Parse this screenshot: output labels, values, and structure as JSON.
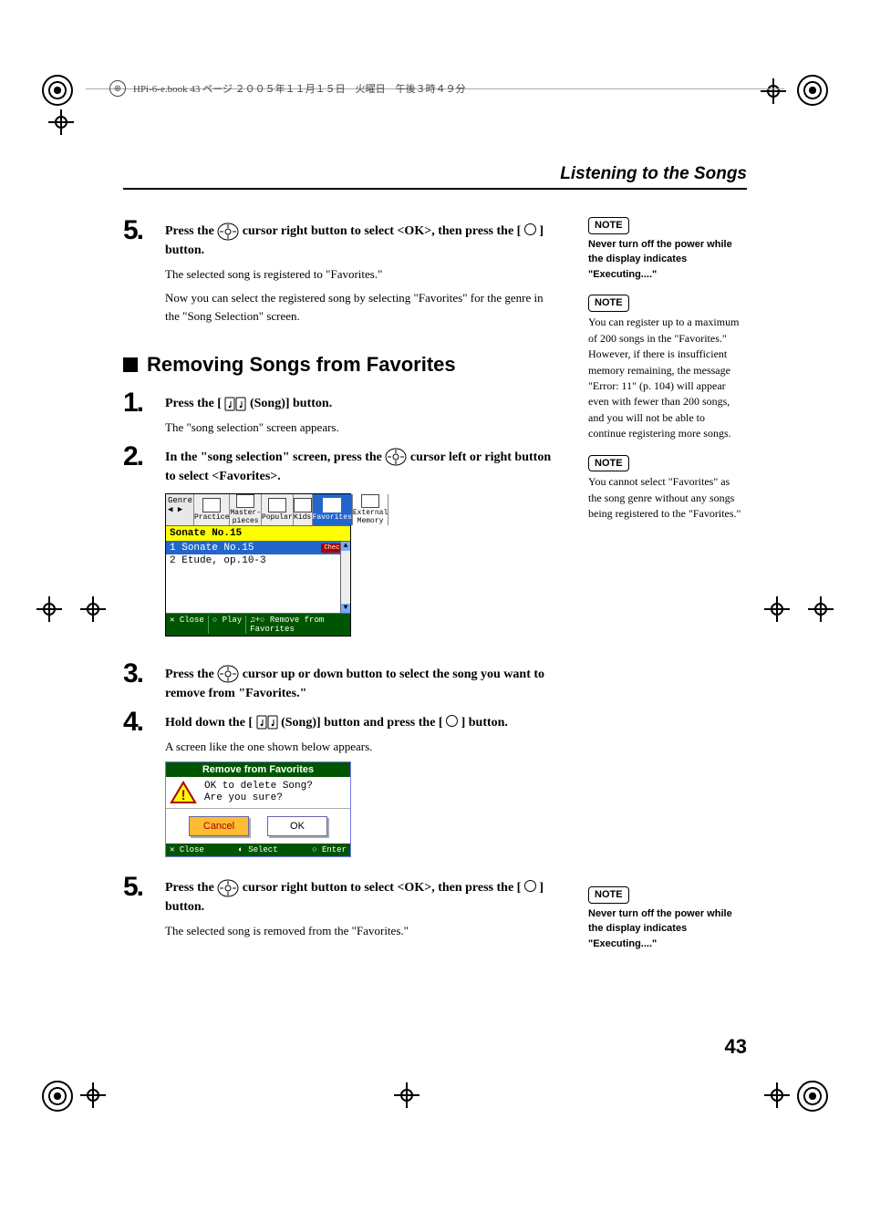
{
  "header_bar": "HPi-6-e.book  43 ページ  ２００５年１１月１５日　火曜日　午後３時４９分",
  "page_title": "Listening to the Songs",
  "page_number": "43",
  "top_continued": {
    "step_num": "5.",
    "instr_parts": {
      "a": "Press the ",
      "b": " cursor right button to select <OK>, then press the [ ",
      "c": " ] button."
    },
    "desc1": "The selected song is registered to \"Favorites.\"",
    "desc2": "Now you can select the registered song by selecting \"Favorites\" for the genre in the \"Song Selection\" screen."
  },
  "section_heading": "Removing Songs from Favorites",
  "steps": {
    "s1": {
      "num": "1.",
      "instr_a": "Press the [ ",
      "instr_b": " (Song)] button.",
      "desc": "The \"song selection\" screen appears."
    },
    "s2": {
      "num": "2.",
      "instr_a": "In the \"song selection\" screen, press the ",
      "instr_b": " cursor left or right button to select <Favorites>."
    },
    "s3": {
      "num": "3.",
      "instr_a": "Press the ",
      "instr_b": " cursor up or down button to select the song you want to remove from \"Favorites.\""
    },
    "s4": {
      "num": "4.",
      "instr_a": "Hold down the [ ",
      "instr_b": " (Song)] button and press the [ ",
      "instr_c": " ] button.",
      "desc": "A screen like the one shown below appears."
    },
    "s5": {
      "num": "5.",
      "instr_a": "Press the ",
      "instr_b": " cursor right button to select <OK>, then press the [ ",
      "instr_c": " ] button.",
      "desc": "The selected song is removed from the \"Favorites.\""
    }
  },
  "screen1": {
    "genre_label": "Genre",
    "tabs": [
      "Practice",
      "Master-pieces",
      "Popular",
      "Kids",
      "Favorites",
      "External Memory"
    ],
    "title": "Sonate No.15",
    "rows": [
      {
        "num": "1",
        "name": "Sonate No.15",
        "badge": "Check"
      },
      {
        "num": "2",
        "name": "Etude, op.10-3",
        "badge": ""
      }
    ],
    "footer": [
      "✕ Close",
      "○ Play",
      "♫+○ Remove from Favorites"
    ]
  },
  "screen2": {
    "header": "Remove from Favorites",
    "msg1": "OK to delete Song?",
    "msg2": "Are you sure?",
    "cancel": "Cancel",
    "ok": "OK",
    "footer_l": "✕ Close",
    "footer_m": "◐ Select",
    "footer_r": "○ Enter"
  },
  "notes": {
    "label": "NOTE",
    "n1": "Never turn off the power while the display indicates \"Executing....\"",
    "n2": "You can register up to a maximum of 200 songs in the \"Favorites.\" However, if there is insufficient memory remaining, the message \"Error: 11\" (p. 104) will appear even with fewer than 200 songs, and you will not be able to continue registering more songs.",
    "n3": "You cannot select \"Favorites\" as the song genre without any songs being registered to the \"Favorites.\"",
    "n4": "Never turn off the power while the display indicates \"Executing....\""
  }
}
